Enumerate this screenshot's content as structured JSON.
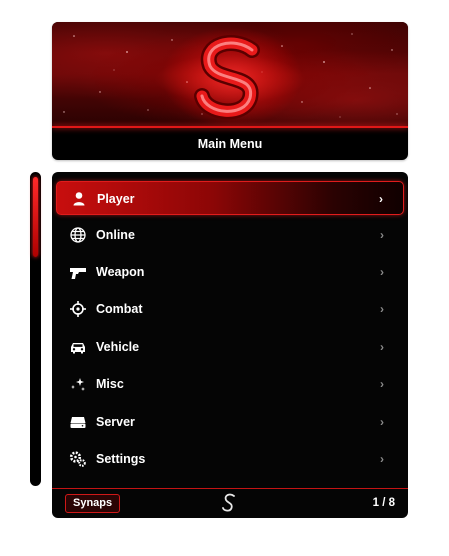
{
  "header": {
    "title": "Main Menu"
  },
  "menu": {
    "items": [
      {
        "label": "Player",
        "icon": "person-icon",
        "active": true
      },
      {
        "label": "Online",
        "icon": "globe-icon"
      },
      {
        "label": "Weapon",
        "icon": "pistol-icon"
      },
      {
        "label": "Combat",
        "icon": "crosshair-icon"
      },
      {
        "label": "Vehicle",
        "icon": "car-icon"
      },
      {
        "label": "Misc",
        "icon": "sparkles-icon"
      },
      {
        "label": "Server",
        "icon": "server-icon"
      },
      {
        "label": "Settings",
        "icon": "gears-icon"
      }
    ],
    "chevron": "›"
  },
  "footer": {
    "brand": "Synaps",
    "page": "1 / 8"
  },
  "scroll": {
    "position_fraction": 0.0,
    "visible_fraction": 0.26
  },
  "colors": {
    "accent": "#d01818",
    "panel": "#050505",
    "text": "#ffffff",
    "chevron": "#8a8a8a"
  }
}
